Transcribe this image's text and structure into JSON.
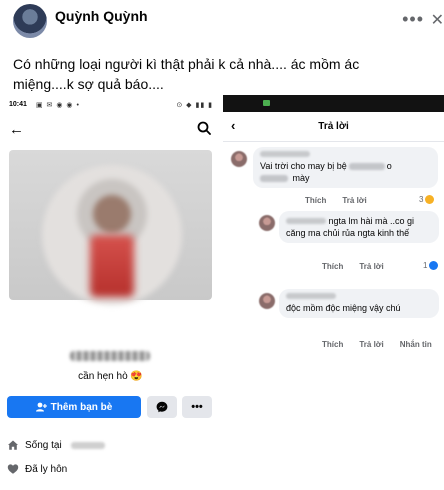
{
  "post": {
    "author": "Quỳnh Quỳnh",
    "more_label": "•••",
    "close_label": "✕",
    "text": "Có những loại người kì thật phải k cả nhà.... ác mồm ác miệng....k sợ quả báo...."
  },
  "left_screen": {
    "time": "10:41",
    "status_icons_left": "▣ ✉ ◉ ◉ •",
    "status_icons_right": "⊙ ◆ ▮▮ ▮",
    "bio": "cần hẹn hò 😍",
    "add_friend_label": "Thêm bạn bè",
    "more_label": "•••",
    "info": [
      {
        "label": "Sống tại"
      },
      {
        "label": "Đã ly hôn"
      }
    ]
  },
  "right_screen": {
    "title": "Trả lời",
    "comments": [
      {
        "text_a": "Vai trời cho may bị bệ",
        "text_b": "o",
        "text_c": "mày",
        "actions": [
          "Thích",
          "Trả lời"
        ],
        "react_count": "3"
      },
      {
        "text_a": "ngta lm hài mà ..co gi căng ma chủi rủa ngta kinh thế",
        "actions": [
          "Thích",
          "Trả lời"
        ],
        "react_count": "1"
      },
      {
        "text_a": "độc mồm độc miệng vậy chú",
        "actions": [
          "Thích",
          "Trả lời",
          "Nhắn tin"
        ]
      }
    ]
  },
  "colors": {
    "accent": "#1877f2",
    "bubble": "#f0f2f5",
    "muted_text": "#65676b"
  }
}
